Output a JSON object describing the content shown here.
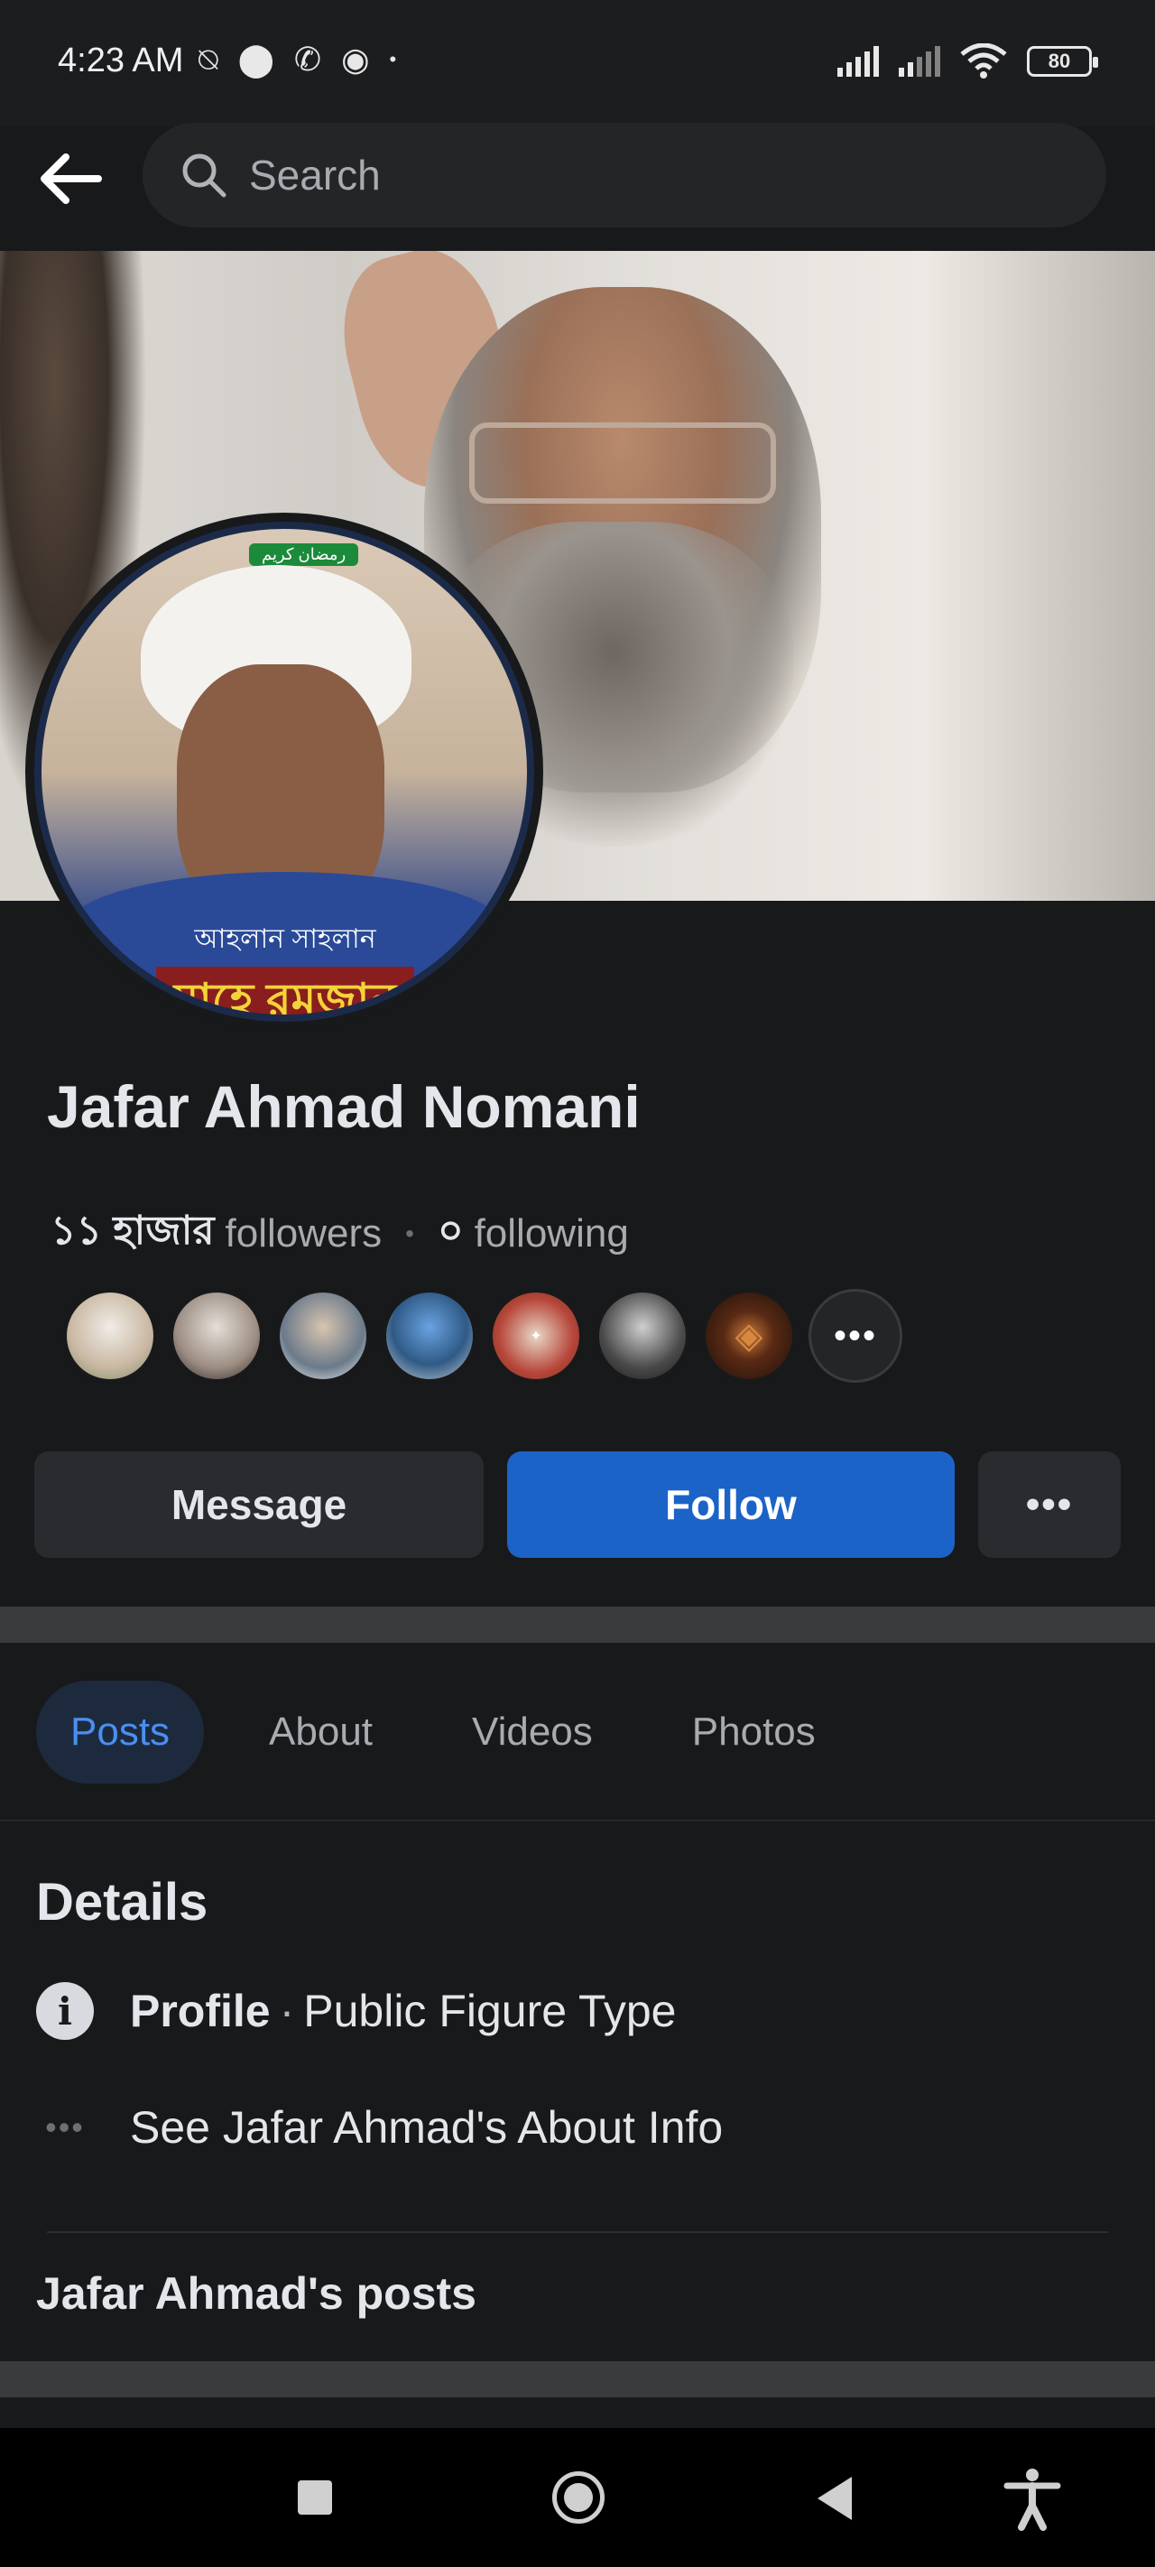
{
  "status_bar": {
    "time": "4:23 AM",
    "left_icons": [
      "muted-call-icon",
      "location-icon",
      "phone-icon",
      "messenger-icon",
      "dot-icon"
    ],
    "battery": "80"
  },
  "header": {
    "search_placeholder": "Search"
  },
  "avatar": {
    "tag": "رمضان كريم",
    "banner_line1": "আহলান সাহলান",
    "banner_line2": "মাহে রমজান"
  },
  "profile": {
    "name": "Jafar Ahmad Nomani",
    "followers_count": "১১ হাজার",
    "followers_label": "followers",
    "following_count": "০",
    "following_label": "following"
  },
  "follower_previews": [
    {
      "name": "follower-1",
      "color": "#c9b7a2"
    },
    {
      "name": "follower-2",
      "color": "#9c8d82"
    },
    {
      "name": "follower-3",
      "color": "#6b7a8a"
    },
    {
      "name": "follower-4",
      "color": "#2f5a86"
    },
    {
      "name": "follower-5",
      "color": "#b7483b"
    },
    {
      "name": "follower-6",
      "color": "#4a4a4a"
    },
    {
      "name": "follower-7",
      "color": "#2a1a12"
    }
  ],
  "actions": {
    "message": "Message",
    "follow": "Follow",
    "more": "•••"
  },
  "tabs": [
    {
      "label": "Posts",
      "active": true
    },
    {
      "label": "About",
      "active": false
    },
    {
      "label": "Videos",
      "active": false
    },
    {
      "label": "Photos",
      "active": false
    }
  ],
  "details": {
    "title": "Details",
    "profile_label": "Profile",
    "separator": "·",
    "profile_type": "Public Figure Type",
    "see_about": "See Jafar Ahmad's About Info"
  },
  "posts_heading": "Jafar Ahmad's posts"
}
